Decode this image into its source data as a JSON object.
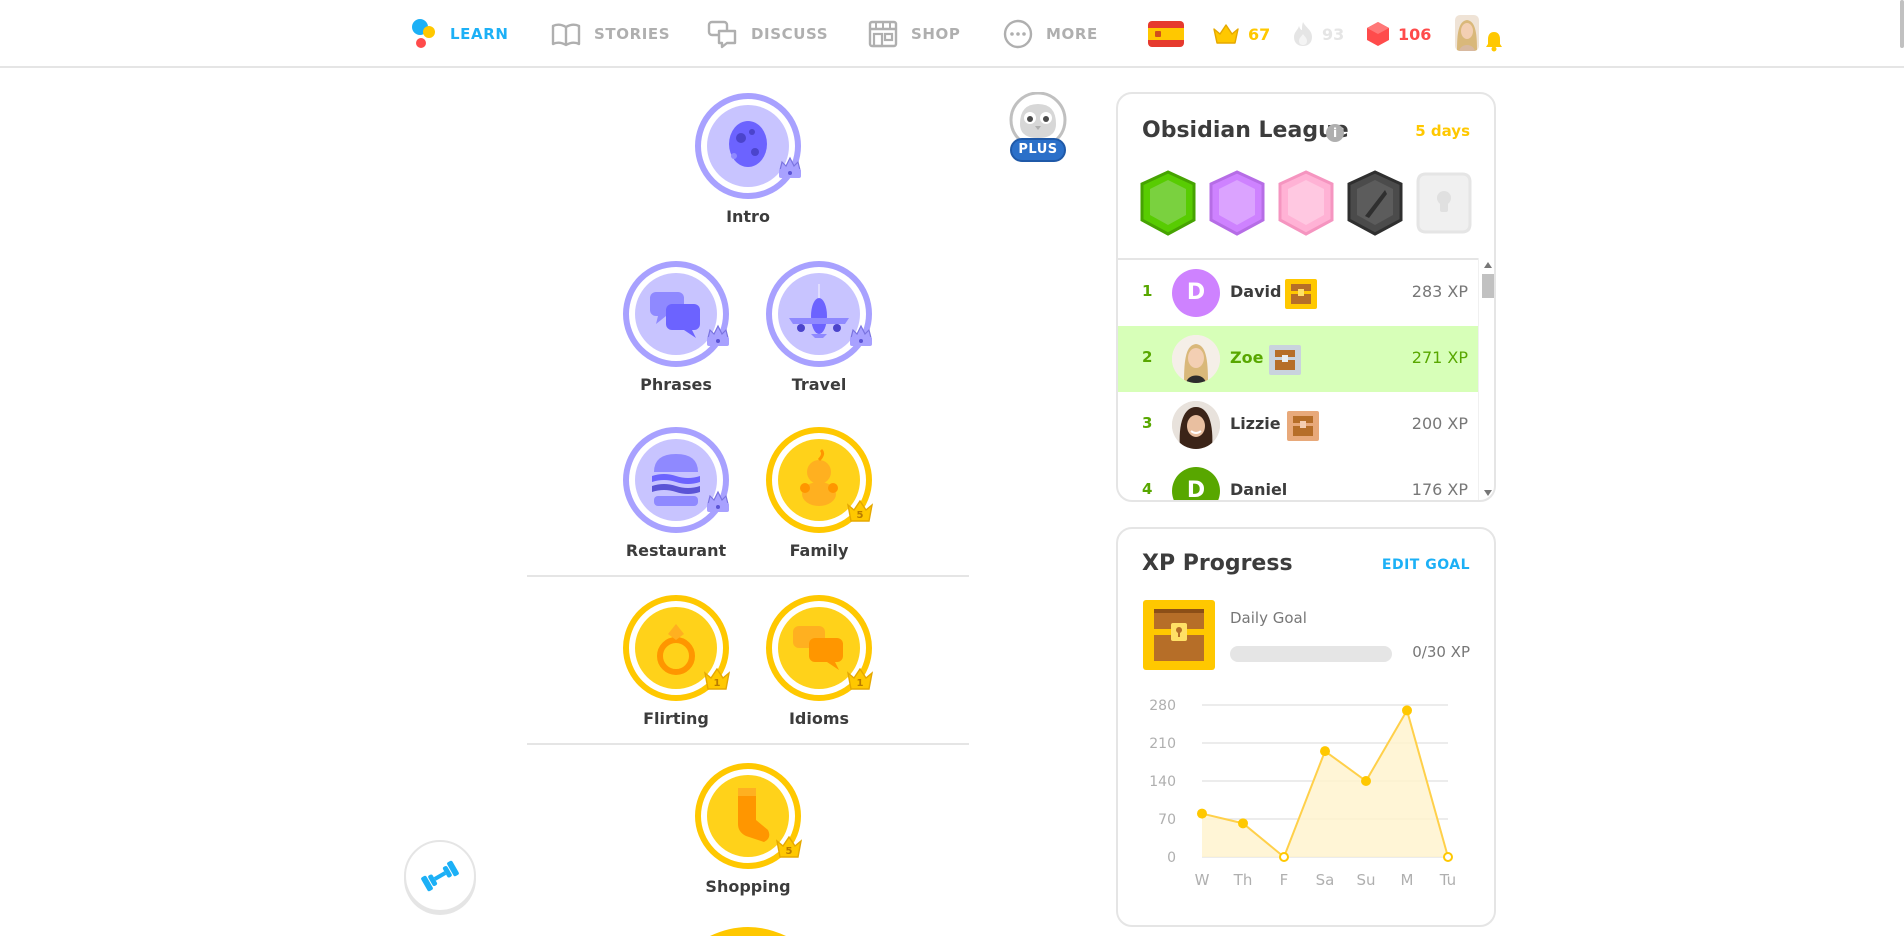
{
  "nav": {
    "learn": "LEARN",
    "stories": "STORIES",
    "discuss": "DISCUSS",
    "shop": "SHOP",
    "more": "MORE"
  },
  "stats": {
    "language_flag": "spanish-flag",
    "crowns": "67",
    "streak": "93",
    "gems": "106"
  },
  "colors": {
    "accent_blue": "#1cb0f6",
    "gold": "#ffc800",
    "gem_red": "#ff4b4b",
    "purple": "#a8a1ff",
    "green": "#58a700"
  },
  "plus_badge": "PLUS",
  "skills": [
    {
      "name": "Intro",
      "style": "legendary",
      "crown": ""
    },
    {
      "name": "Phrases",
      "style": "legendary",
      "crown": ""
    },
    {
      "name": "Travel",
      "style": "legendary",
      "crown": ""
    },
    {
      "name": "Restaurant",
      "style": "legendary",
      "crown": ""
    },
    {
      "name": "Family",
      "style": "gold",
      "crown": "5"
    },
    {
      "name": "Flirting",
      "style": "gold",
      "crown": "1"
    },
    {
      "name": "Idioms",
      "style": "gold",
      "crown": "1"
    },
    {
      "name": "Shopping",
      "style": "gold",
      "crown": "5"
    }
  ],
  "league": {
    "title": "Obsidian League",
    "days_left": "5 days",
    "rows": [
      {
        "rank": "1",
        "name": "David",
        "initial": "D",
        "xp": "283 XP",
        "chest": "gold"
      },
      {
        "rank": "2",
        "name": "Zoe",
        "initial": "",
        "xp": "271 XP",
        "chest": "silver"
      },
      {
        "rank": "3",
        "name": "Lizzie",
        "initial": "",
        "xp": "200 XP",
        "chest": "bronze"
      },
      {
        "rank": "4",
        "name": "Daniel",
        "initial": "D",
        "xp": "176 XP",
        "chest": ""
      }
    ]
  },
  "xp_progress": {
    "title": "XP Progress",
    "edit_goal": "EDIT GOAL",
    "daily_goal_label": "Daily Goal",
    "daily_goal_value": "0/30 XP",
    "daily_goal_fraction": 0
  },
  "chart_data": {
    "type": "area",
    "categories": [
      "W",
      "Th",
      "F",
      "Sa",
      "Su",
      "M",
      "Tu"
    ],
    "values": [
      80,
      62,
      0,
      195,
      140,
      270,
      0
    ],
    "yticks": [
      "0",
      "70",
      "140",
      "210",
      "280"
    ],
    "ylim": [
      0,
      280
    ],
    "grid": true,
    "title": "",
    "xlabel": "",
    "ylabel": ""
  }
}
